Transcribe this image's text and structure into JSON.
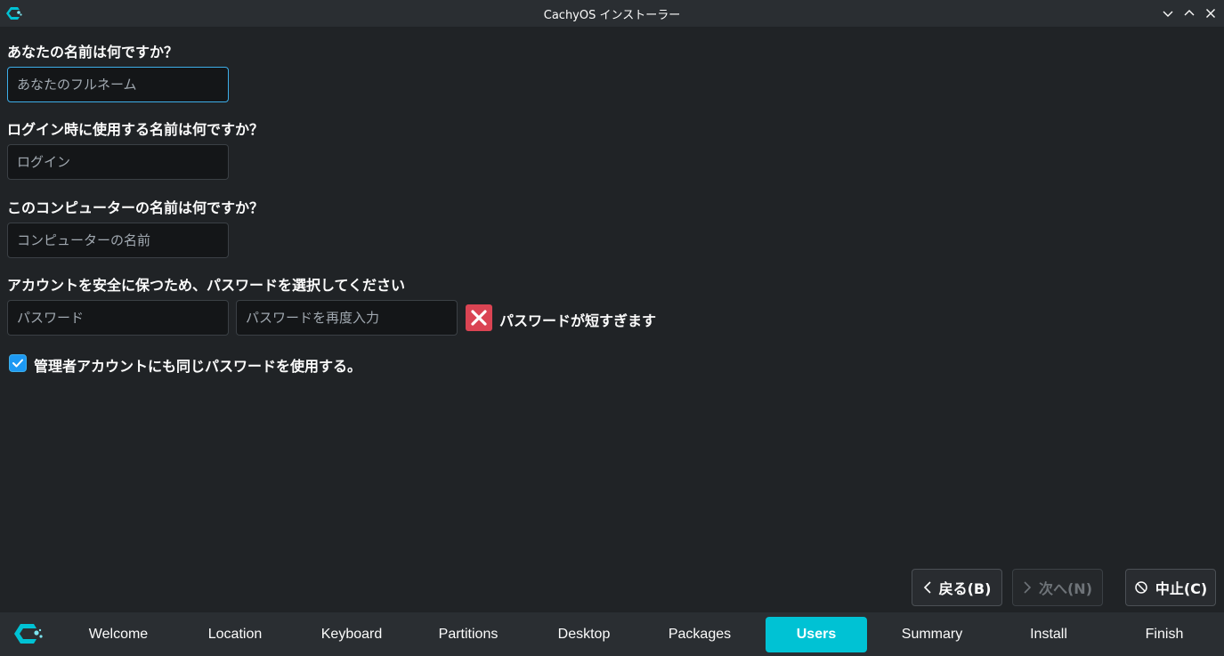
{
  "window": {
    "title": "CachyOS インストーラー"
  },
  "form": {
    "fullname": {
      "label": "あなたの名前は何ですか？",
      "placeholder": "あなたのフルネーム",
      "value": ""
    },
    "login": {
      "label": "ログイン時に使用する名前は何ですか？",
      "placeholder": "ログイン",
      "value": ""
    },
    "hostname": {
      "label": "このコンピューターの名前は何ですか？",
      "placeholder": "コンピューターの名前",
      "value": ""
    },
    "password": {
      "label": "アカウントを安全に保つため、パスワードを選択してください",
      "placeholder": "パスワード",
      "repeat_placeholder": "パスワードを再度入力",
      "error": "パスワードが短すぎます"
    },
    "admin_same_password": {
      "label": "管理者アカウントにも同じパスワードを使用する。",
      "checked": true
    }
  },
  "buttons": {
    "back": "戻る(B)",
    "next": "次へ(N)",
    "cancel": "中止(C)"
  },
  "nav": {
    "items": [
      "Welcome",
      "Location",
      "Keyboard",
      "Partitions",
      "Desktop",
      "Packages",
      "Users",
      "Summary",
      "Install",
      "Finish"
    ],
    "active": "Users"
  },
  "colors": {
    "accent": "#00c2d4",
    "focus": "#3daee9",
    "error": "#da4453",
    "checkbox": "#1d99f3"
  }
}
